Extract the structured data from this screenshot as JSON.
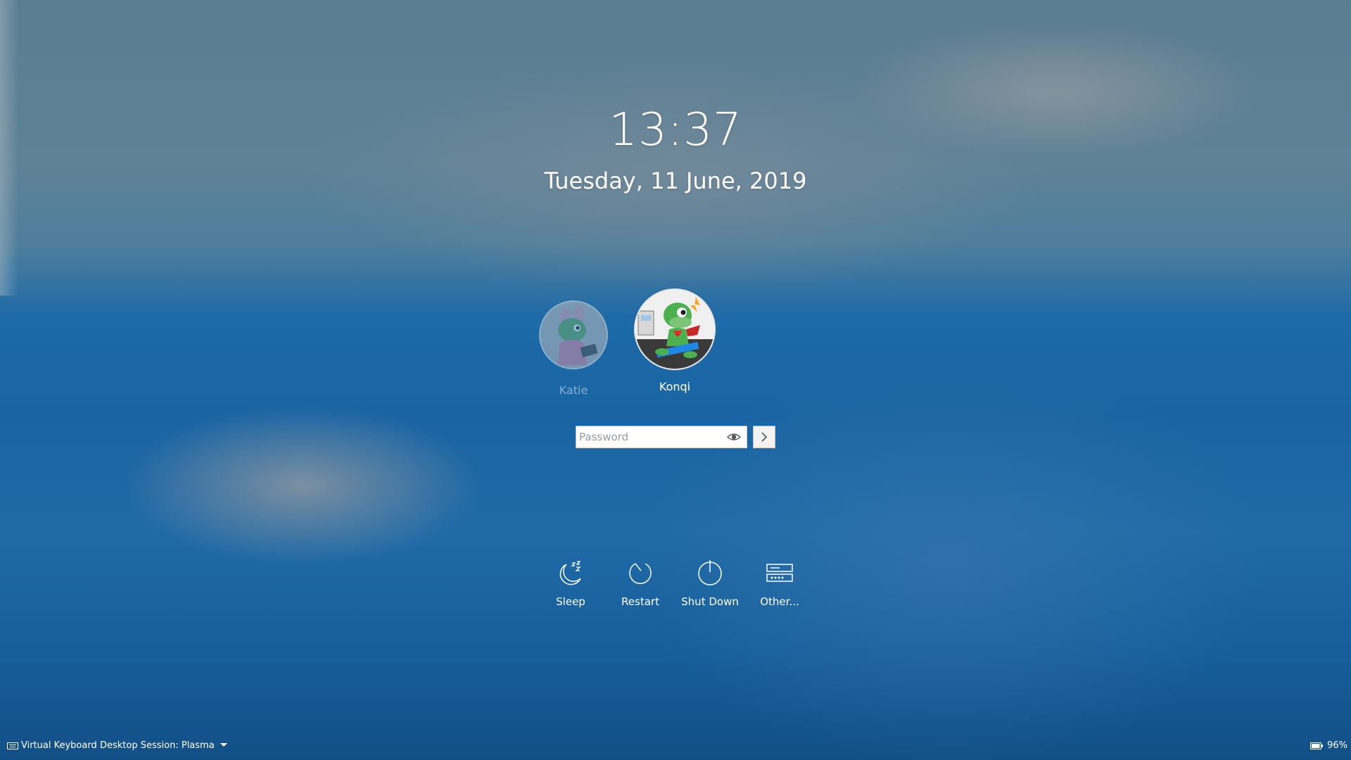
{
  "clock": {
    "time": "13:37",
    "date": "Tuesday, 11 June, 2019"
  },
  "users": [
    {
      "name": "Katie",
      "selected": false,
      "avatar_icon": "katie-avatar"
    },
    {
      "name": "Konqi",
      "selected": true,
      "avatar_icon": "konqi-avatar"
    }
  ],
  "login": {
    "password_placeholder": "Password",
    "password_value": "",
    "reveal_icon": "eye-icon",
    "submit_icon": "arrow-right-icon"
  },
  "actions": [
    {
      "label": "Sleep",
      "icon": "sleep-icon"
    },
    {
      "label": "Restart",
      "icon": "restart-icon"
    },
    {
      "label": "Shut Down",
      "icon": "shutdown-icon"
    },
    {
      "label": "Other...",
      "icon": "other-icon"
    }
  ],
  "footer": {
    "virtual_keyboard": "Virtual Keyboard",
    "session": "Desktop Session: Plasma",
    "battery": "96%",
    "battery_level": 0.96
  },
  "colors": {
    "text": "#ffffff",
    "background_top": "#5b7d92",
    "background_bottom": "#124f86"
  }
}
